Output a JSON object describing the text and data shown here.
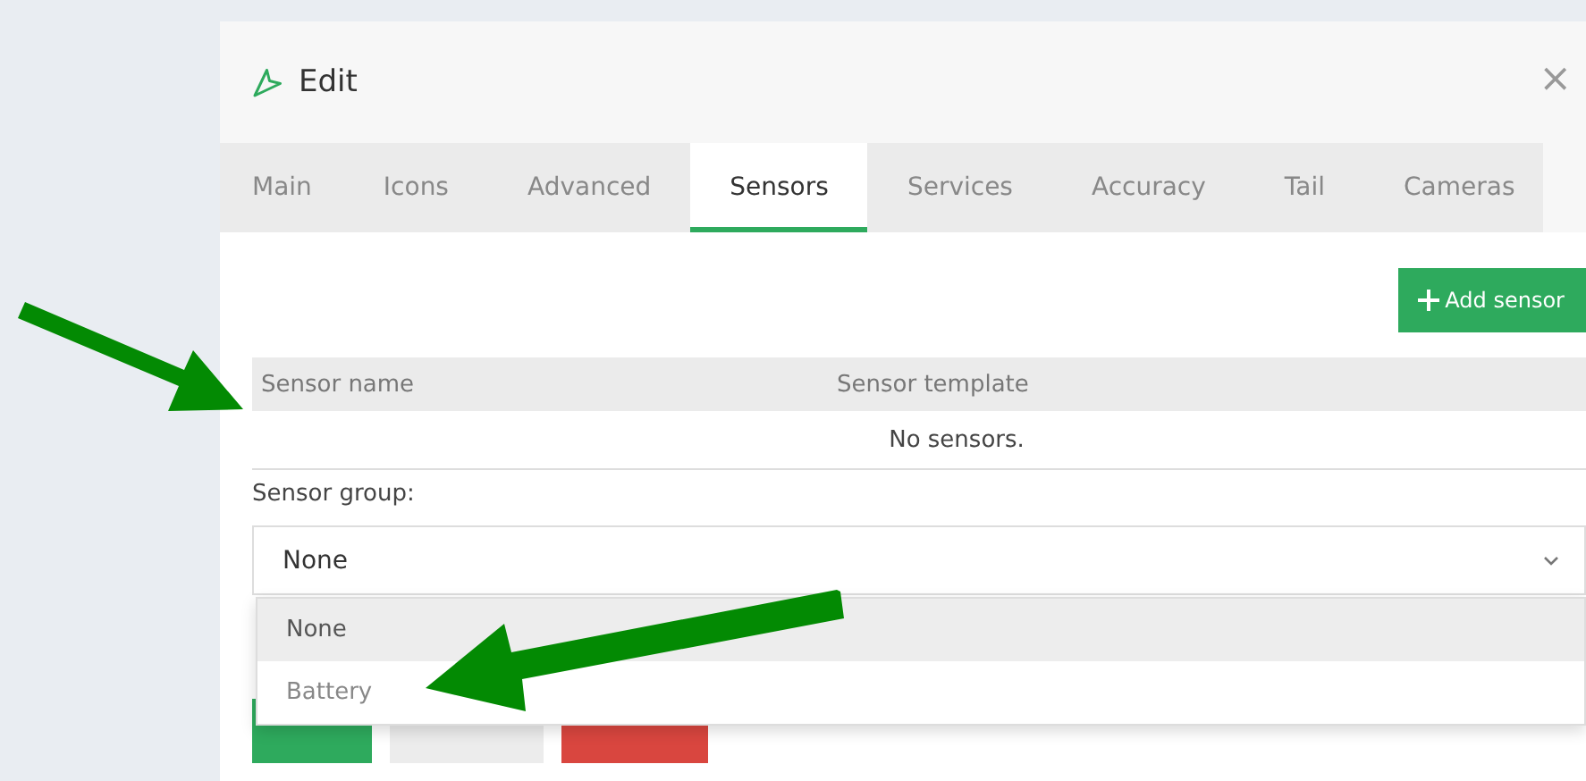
{
  "dialog": {
    "title": "Edit",
    "close": "×"
  },
  "tabs": [
    {
      "label": "Main",
      "selected": false
    },
    {
      "label": "Icons",
      "selected": false
    },
    {
      "label": "Advanced",
      "selected": false
    },
    {
      "label": "Sensors",
      "selected": true
    },
    {
      "label": "Services",
      "selected": false
    },
    {
      "label": "Accuracy",
      "selected": false
    },
    {
      "label": "Tail",
      "selected": false
    },
    {
      "label": "Cameras",
      "selected": false
    }
  ],
  "add_button": {
    "label": "Add sensor"
  },
  "table": {
    "columns": [
      "Sensor name",
      "Sensor template"
    ],
    "empty_text": "No sensors."
  },
  "sensor_group": {
    "label": "Sensor group:",
    "value": "None",
    "expanded": true,
    "options": [
      {
        "label": "None",
        "selected": true
      },
      {
        "label": "Battery",
        "selected": false
      }
    ]
  },
  "footer_buttons": [
    {
      "kind": "primary"
    },
    {
      "kind": "default"
    },
    {
      "kind": "danger"
    }
  ]
}
